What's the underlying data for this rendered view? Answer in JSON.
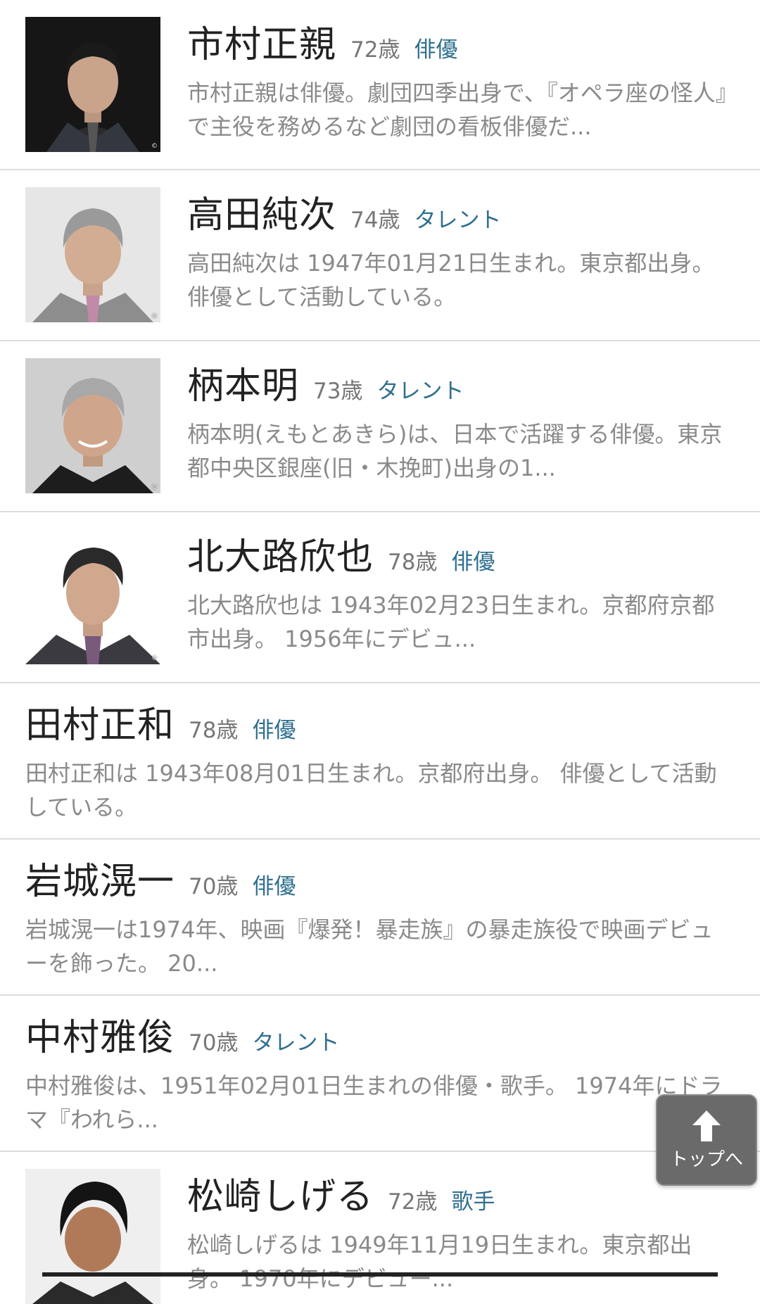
{
  "items": [
    {
      "name": "市村正親",
      "age": "72歳",
      "category": "俳優",
      "description": "市村正親は俳優。劇団四季出身で、『オペラ座の怪人』で主役を務めるなど劇団の看板俳優だ...",
      "has_photo": true
    },
    {
      "name": "高田純次",
      "age": "74歳",
      "category": "タレント",
      "description": "高田純次は 1947年01月21日生まれ。東京都出身。俳優として活動している。",
      "has_photo": true
    },
    {
      "name": "柄本明",
      "age": "73歳",
      "category": "タレント",
      "description": "柄本明(えもとあきら)は、日本で活躍する俳優。東京都中央区銀座(旧・木挽町)出身の1...",
      "has_photo": true
    },
    {
      "name": "北大路欣也",
      "age": "78歳",
      "category": "俳優",
      "description": "北大路欣也は 1943年02月23日生まれ。京都府京都市出身。 1956年にデビュ...",
      "has_photo": true
    },
    {
      "name": "田村正和",
      "age": "78歳",
      "category": "俳優",
      "description": "田村正和は 1943年08月01日生まれ。京都府出身。 俳優として活動している。",
      "has_photo": false
    },
    {
      "name": "岩城滉一",
      "age": "70歳",
      "category": "俳優",
      "description": "岩城滉一は1974年、映画『爆発！暴走族』の暴走族役で映画デビューを飾った。 20...",
      "has_photo": false
    },
    {
      "name": "中村雅俊",
      "age": "70歳",
      "category": "タレント",
      "description": "中村雅俊は、1951年02月01日生まれの俳優・歌手。 1974年にドラマ『われら...",
      "has_photo": false
    },
    {
      "name": "松崎しげる",
      "age": "72歳",
      "category": "歌手",
      "description": "松崎しげるは 1949年11月19日生まれ。東京都出身。 1970年にデビュー...",
      "has_photo": true
    }
  ],
  "scroll_top_button": {
    "label": "トップへ",
    "icon": "arrow-up-icon"
  },
  "colors": {
    "category": "#2f6f8f",
    "divider": "#dcdcdc",
    "button_bg": "#6a6a6a"
  }
}
